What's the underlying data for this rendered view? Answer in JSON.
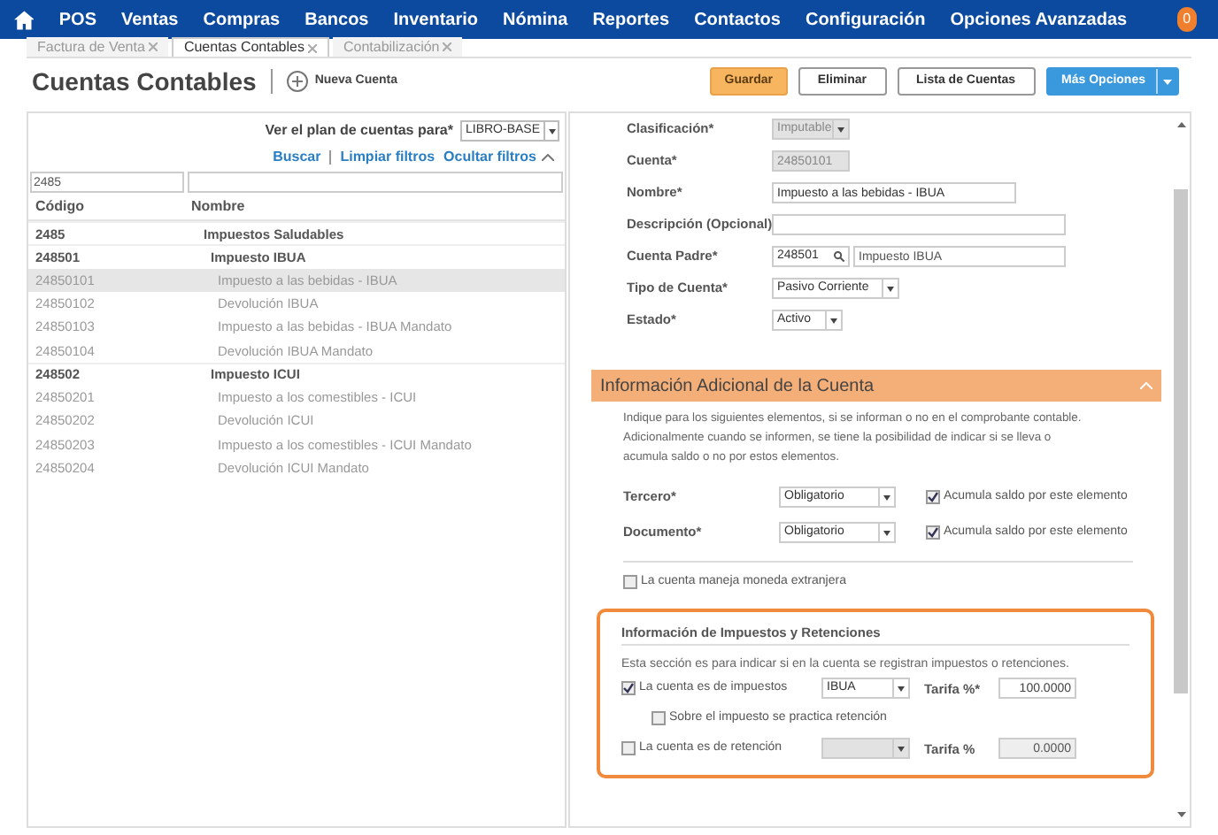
{
  "nav": {
    "items": [
      "POS",
      "Ventas",
      "Compras",
      "Bancos",
      "Inventario",
      "Nómina",
      "Reportes",
      "Contactos",
      "Configuración",
      "Opciones Avanzadas"
    ],
    "avatar": "0"
  },
  "tabs": [
    {
      "label": "Factura de Venta",
      "selected": false
    },
    {
      "label": "Cuentas Contables",
      "selected": true
    },
    {
      "label": "Contabilización",
      "selected": false
    }
  ],
  "header": {
    "title": "Cuentas Contables",
    "new_label": "Nueva Cuenta",
    "buttons": [
      {
        "label": "Guardar",
        "kind": "primary"
      },
      {
        "label": "Eliminar",
        "kind": "default"
      },
      {
        "label": "Lista de Cuentas",
        "kind": "default"
      },
      {
        "label": "Más Opciones",
        "kind": "split"
      }
    ]
  },
  "filter": {
    "label": "Ver el plan de cuentas para*",
    "value": "LIBRO-BASE",
    "links": [
      "Buscar",
      "Limpiar filtros",
      "Ocultar filtros"
    ],
    "code_value": "2485"
  },
  "table": {
    "columns": [
      "Código",
      "Nombre"
    ],
    "rows": [
      {
        "code": "2485",
        "name": "Impuestos Saludables",
        "kind": "group",
        "selected": false,
        "children": [
          {
            "code": "248501",
            "name": "Impuesto IBUA",
            "kind": "group",
            "selected": false,
            "children": [
              {
                "code": "24850101",
                "name": "Impuesto a las bebidas - IBUA",
                "kind": "account",
                "selected": true
              },
              {
                "code": "24850102",
                "name": "Devolución IBUA",
                "kind": "account",
                "selected": false
              },
              {
                "code": "24850103",
                "name": "Impuesto a las bebidas - IBUA Mandato",
                "kind": "account",
                "selected": false
              },
              {
                "code": "24850104",
                "name": "Devolución IBUA Mandato",
                "kind": "account",
                "selected": false
              }
            ]
          },
          {
            "code": "248502",
            "name": "Impuesto ICUI",
            "kind": "group",
            "selected": false,
            "children": [
              {
                "code": "24850201",
                "name": "Impuesto a los comestibles - ICUI",
                "kind": "account",
                "selected": false
              },
              {
                "code": "24850202",
                "name": "Devolución ICUI",
                "kind": "account",
                "selected": false
              },
              {
                "code": "24850203",
                "name": "Impuesto a los comestibles - ICUI Mandato",
                "kind": "account",
                "selected": false
              },
              {
                "code": "24850204",
                "name": "Devolución ICUI Mandato",
                "kind": "account",
                "selected": false
              }
            ]
          }
        ]
      }
    ]
  },
  "form": [
    {
      "label": "Clasificación*",
      "kind": "select",
      "value": "Imputable",
      "disabled": true
    },
    {
      "label": "Cuenta*",
      "kind": "text",
      "value": "24850101",
      "disabled": true
    },
    {
      "label": "Nombre*",
      "kind": "text",
      "value": "Impuesto a las bebidas - IBUA",
      "disabled": false
    },
    {
      "label": "Descripción (Opcional)",
      "kind": "text",
      "disabled": false
    },
    {
      "label": "Cuenta Padre*",
      "kind": "lookup",
      "value": "248501",
      "value2": "Impuesto IBUA",
      "disabled": false
    },
    {
      "label": "Tipo de Cuenta*",
      "kind": "select",
      "value": "Pasivo Corriente",
      "disabled": false
    },
    {
      "label": "Estado*",
      "kind": "select",
      "value": "Activo",
      "disabled": false
    }
  ],
  "additional": {
    "title": "Información Adicional de la Cuenta",
    "expanded": true,
    "text": "Indique para los siguientes elementos, si se informan o no en el comprobante contable. Adicionalmente cuando se informen, se tiene la posibilidad de indicar si se lleva o acumula saldo o no por estos elementos.",
    "rows": [
      {
        "label": "Tercero*",
        "value": "Obligatorio",
        "check_label": "Acumula saldo por este elemento",
        "checked": true
      },
      {
        "label": "Documento*",
        "value": "Obligatorio",
        "check_label": "Acumula saldo por este elemento",
        "checked": true
      }
    ],
    "foreign": {
      "label": "La cuenta maneja moneda extranjera",
      "checked": false
    }
  },
  "taxes": {
    "title": "Información de Impuestos y Retenciones",
    "text": "Esta sección es para indicar si en la cuenta se registran impuestos o retenciones.",
    "tax": {
      "label": "La cuenta es de impuestos",
      "checked": true,
      "value": "IBUA",
      "rate_label": "Tarifa %*",
      "rate": "100.0000"
    },
    "withholding_on_tax": {
      "label": "Sobre el impuesto se practica retención",
      "checked": false
    },
    "withholding": {
      "label": "La cuenta es de retención",
      "checked": false,
      "rate_label": "Tarifa %",
      "rate": "0.0000"
    }
  }
}
